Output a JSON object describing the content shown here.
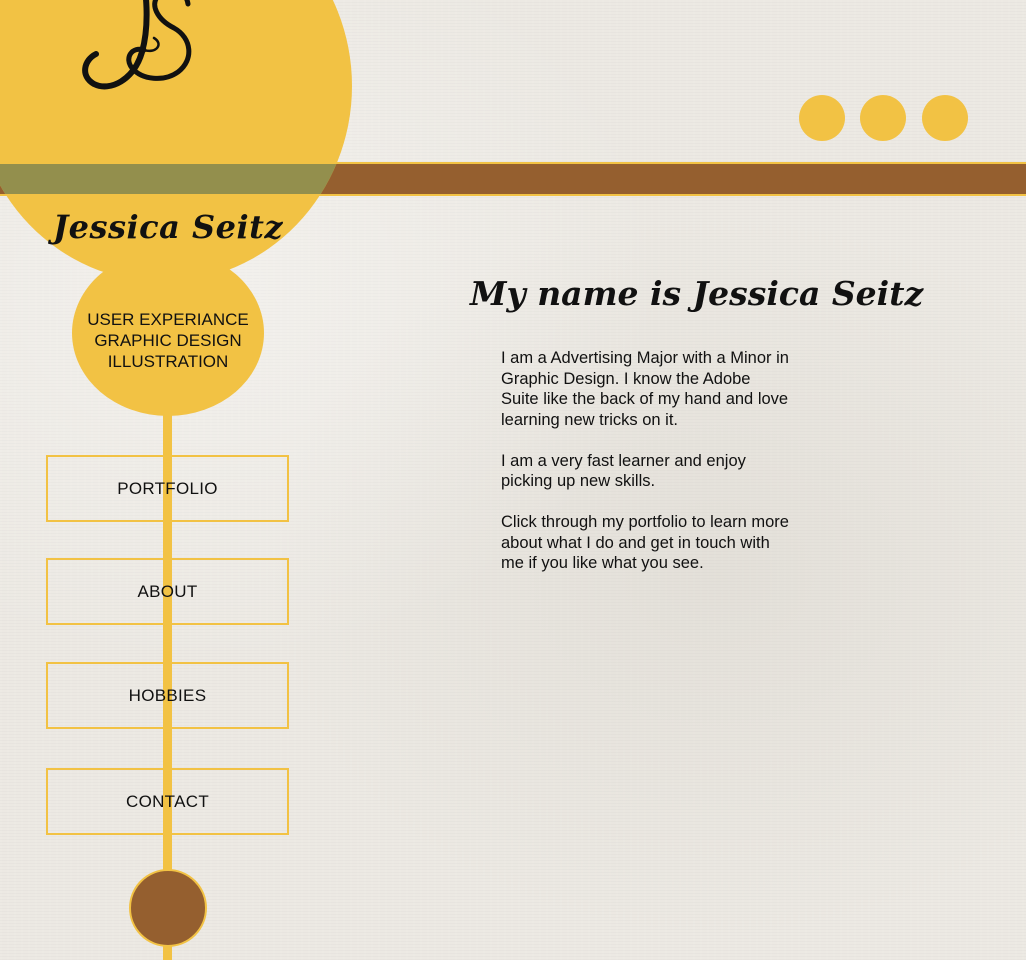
{
  "brand": {
    "logo_name": "Jessica Seitz",
    "accent_color": "#f2c244",
    "band_color": "#955f2f",
    "background_color": "#ece9e3"
  },
  "services": [
    "USER EXPERIANCE",
    "GRAPHIC DESIGN",
    "ILLUSTRATION"
  ],
  "nav": [
    {
      "label": "PORTFOLIO"
    },
    {
      "label": "ABOUT"
    },
    {
      "label": "HOBBIES"
    },
    {
      "label": "CONTACT"
    }
  ],
  "main": {
    "heading": "My name is Jessica Seitz",
    "paragraphs": [
      "I am a Advertising Major with a Minor in Graphic Design. I know the Adobe Suite like the back of my hand and love learning new tricks on it.",
      "I am a very fast learner and enjoy picking up new skills.",
      "Click through my portfolio to learn more about what I do and get in touch with me if you like what you see."
    ]
  },
  "icons": {
    "monogram": "js-monogram-icon",
    "dots": [
      "dot-icon",
      "dot-icon",
      "dot-icon"
    ]
  }
}
